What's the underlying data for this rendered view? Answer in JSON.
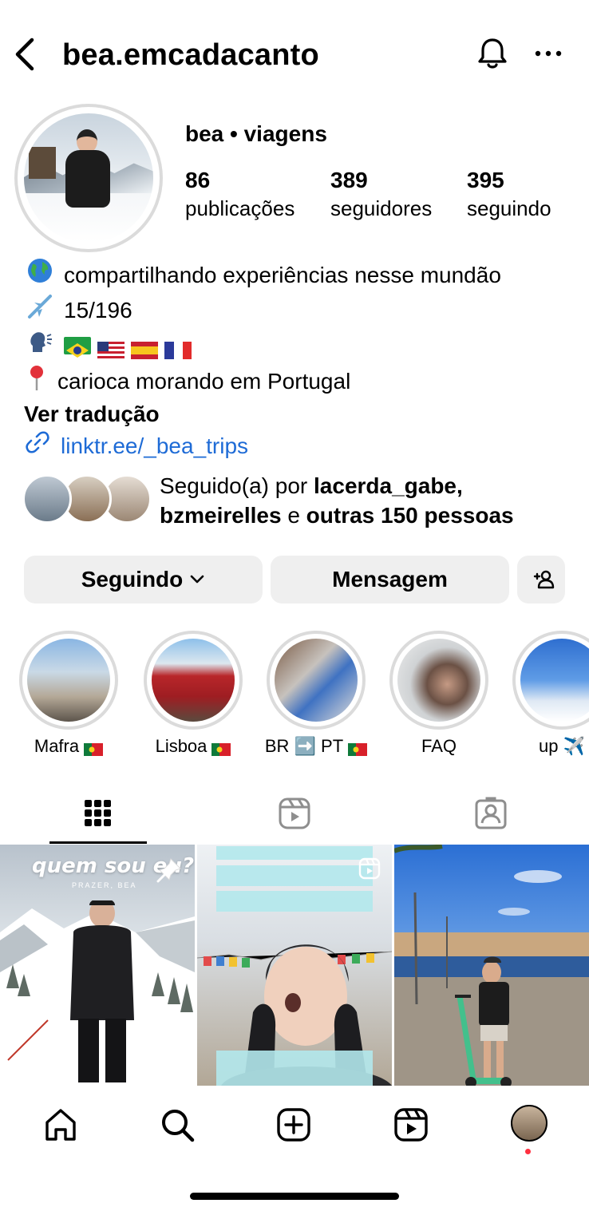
{
  "header": {
    "username": "bea.emcadacanto",
    "back_icon": "chevron-left-icon",
    "bell_icon": "bell-icon",
    "more_icon": "ellipsis-icon"
  },
  "profile": {
    "display_name": "bea • viagens",
    "stats": [
      {
        "value": "86",
        "label": "publicações"
      },
      {
        "value": "389",
        "label": "seguidores"
      },
      {
        "value": "395",
        "label": "seguindo"
      }
    ],
    "bio": {
      "line1": "compartilhando experiências nesse mundão",
      "line2": "15/196",
      "line4": "carioca morando em Portugal",
      "translate": "Ver tradução",
      "link": "linktr.ee/_bea_trips"
    },
    "followed_by": {
      "prefix": "Seguido(a) por",
      "user1": "lacerda_gabe,",
      "user2": "bzmeirelles",
      "connector": "e",
      "others": "outras 150 pessoas"
    }
  },
  "actions": {
    "following": "Seguindo",
    "message": "Mensagem"
  },
  "highlights": [
    {
      "label": "Mafra",
      "flag": "pt"
    },
    {
      "label": "Lisboa",
      "flag": "pt"
    },
    {
      "label": "BR ➡️ PT",
      "flag": "pt"
    },
    {
      "label": "FAQ",
      "flag": ""
    },
    {
      "label": "up ✈️",
      "flag": ""
    }
  ],
  "posts": {
    "post1_title": "quem sou eu?",
    "post1_subtitle": "PRAZER, BEA"
  },
  "colors": {
    "link": "#1e6bd6",
    "button_bg": "#efefef",
    "notification_dot": "#ff3040"
  }
}
